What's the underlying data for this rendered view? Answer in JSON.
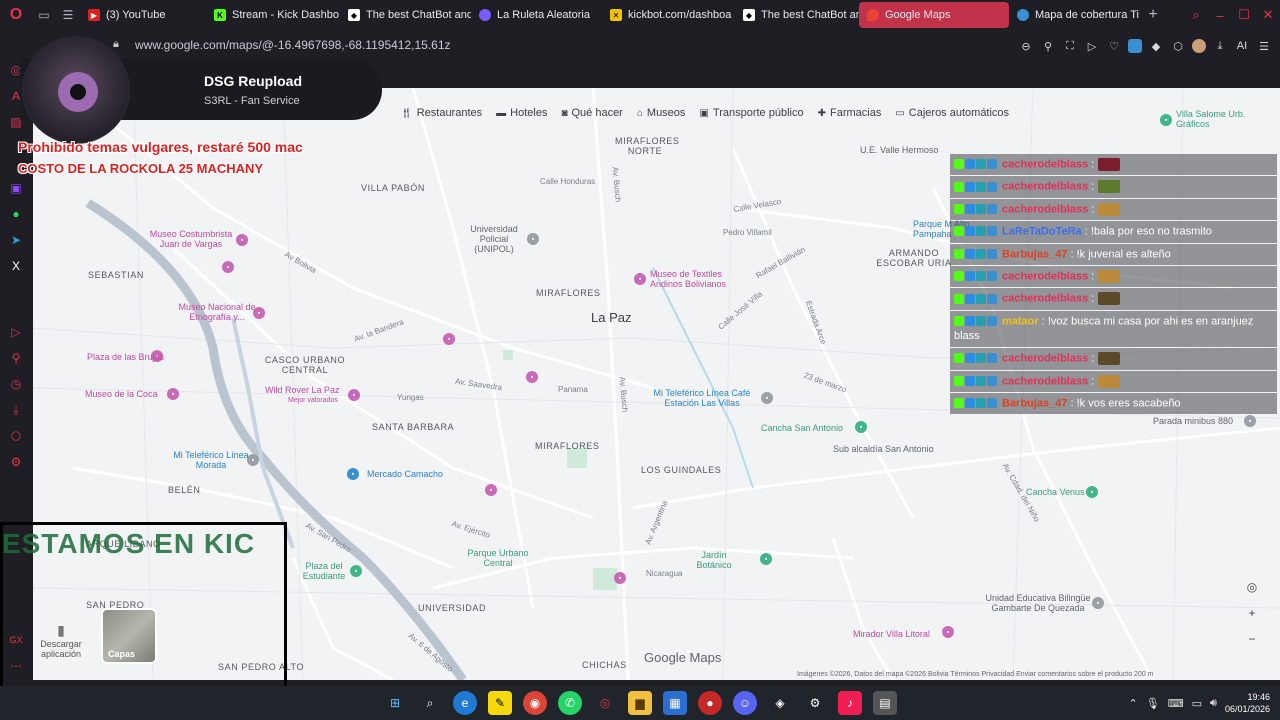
{
  "tabs": [
    {
      "label": "(3) YouTube",
      "color": "#e02020",
      "icon": "youtube-icon"
    },
    {
      "label": "Stream - Kick Dashbo",
      "color": "#53fc18",
      "icon": "kick-icon"
    },
    {
      "label": "The best ChatBot and",
      "color": "#ffffff",
      "icon": "chatbot-icon"
    },
    {
      "label": "La Ruleta Aleatoria",
      "color": "#7a5cff",
      "icon": "roulette-icon"
    },
    {
      "label": "kickbot.com/dashboa",
      "color": "#f2c200",
      "icon": "kickbot-icon"
    },
    {
      "label": "The best ChatBot and",
      "color": "#ffffff",
      "icon": "chatbot-icon"
    },
    {
      "label": "Google Maps",
      "color": "#ea4335",
      "icon": "maps-icon",
      "active": true
    },
    {
      "label": "Mapa de cobertura Ti",
      "color": "#3a8fd1",
      "icon": "coverage-icon"
    }
  ],
  "address": {
    "url": "www.google.com/maps/@-16.4967698,-68.1195412,15.61z"
  },
  "stream": {
    "title": "DSG Reupload",
    "subtitle": "S3RL - Fan Service"
  },
  "rules": {
    "line1": "Prohibido temas vulgares, restaré 500 mac",
    "line2": "COSTO DE LA ROCKOLA 25 MACHANY"
  },
  "chips": [
    {
      "label": "Restaurantes",
      "icon": "fork-knife-icon"
    },
    {
      "label": "Hoteles",
      "icon": "bed-icon"
    },
    {
      "label": "Qué hacer",
      "icon": "camera-icon"
    },
    {
      "label": "Museos",
      "icon": "museum-icon"
    },
    {
      "label": "Transporte público",
      "icon": "bus-icon"
    },
    {
      "label": "Farmacias",
      "icon": "pharmacy-icon"
    },
    {
      "label": "Cajeros automáticos",
      "icon": "atm-icon"
    }
  ],
  "chat": [
    {
      "user": "cacherodelblass",
      "msg": " :",
      "user_color": "#e0305a",
      "emote": "#7a1d2c"
    },
    {
      "user": "cacherodelblass",
      "msg": " :",
      "user_color": "#e0305a",
      "emote": "#5d7a2c"
    },
    {
      "user": "cacherodelblass",
      "msg": " :",
      "user_color": "#e0305a",
      "emote": "#b88a3a"
    },
    {
      "user": "LaReTaDoTeRa",
      "msg": " : !bala por eso no trasmito",
      "user_color": "#3a6ee8",
      "emote": ""
    },
    {
      "user": "Barbujas_47",
      "msg": " : !k juvenal es alteño",
      "user_color": "#e04020",
      "emote": ""
    },
    {
      "user": "cacherodelblass",
      "msg": " :",
      "user_color": "#e0305a",
      "emote": "#b88a3a"
    },
    {
      "user": "cacherodelblass",
      "msg": " :",
      "user_color": "#e0305a",
      "emote": "#5a4a2a"
    },
    {
      "user": "mataor",
      "msg": " : !voz busca mi casa por ahi es en aranjuez blass",
      "user_color": "#f0c020",
      "emote": ""
    },
    {
      "user": "cacherodelblass",
      "msg": " :",
      "user_color": "#e0305a",
      "emote": "#5a4a2a"
    },
    {
      "user": "cacherodelblass",
      "msg": " :",
      "user_color": "#e0305a",
      "emote": "#b88a3a"
    },
    {
      "user": "Barbujas_47",
      "msg": " : !k vos eres sacabeño",
      "user_color": "#e04020",
      "emote": ""
    }
  ],
  "map": {
    "neighborhoods": [
      "VILLA PABÓN",
      "SEBASTIAN",
      "CASCO URBANO CENTRAL",
      "SANTA BARBARA",
      "MIRAFLORES NORTE",
      "MIRAFLORES",
      "MIRAFLORES",
      "LOS GUINDALES",
      "BELÉN",
      "SAN PEDRO",
      "UNIVERSIDAD",
      "CHICHAS",
      "ARMANDO ESCOBAR URIA",
      "SAN PEDRO ALTO",
      "ARQUE LIBANO"
    ],
    "city": "La Paz",
    "pois": [
      "Museo Costumbrista Juan de Vargas",
      "Museo Nacional de Etnografía y...",
      "Museo de Textiles Andinos Bolivianos",
      "Wild Rover La Paz",
      "Mejor valorados",
      "Mercado Camacho",
      "Mi Teleférico Línea Café Estación Las Villas",
      "Cancha San Antonio",
      "Sub alcaldía San Antonio",
      "Parada minibus 880",
      "Cancha Venus",
      "Mi Teleférico Línea Morada",
      "Parque Urbano Central",
      "Jardín Botánico",
      "Plaza del Estudiante",
      "Unidad Educativa Bilingüe Gambarte De Quezada",
      "Mirador Villa Litoral",
      "Universidad Policial (UNIPOL)",
      "Museo de la Coca",
      "Plaza de las Brujas",
      "U.E. Valle Hermoso",
      "Villa Salome Urb. Gráficos",
      "Parque M Alto Pampaha"
    ],
    "streets": [
      "Calle Honduras",
      "Av. Busch",
      "Av. Busch",
      "Av. Saavedra",
      "Panama",
      "Av. Ejército",
      "Av. Argentina",
      "Nicaragua",
      "Av. Cdad. del Niño",
      "23 de marzo",
      "Av. 6 de Agosto",
      "Yungas",
      "Estrada Arce",
      "Av. San Pedro",
      "Av Bolivia",
      "Pedro Villamil",
      "Calle Velasco",
      "Rafael Ballivián",
      "Calle José Villa",
      "Av. la Bandera"
    ],
    "logo": "Google Maps",
    "attribution": "Imágenes ©2026, Datos del mapa ©2026   Bolivia   Términos   Privacidad   Enviar comentarios sobre el producto   200 m",
    "download_app": "Descargar aplicación",
    "layers": "Capas"
  },
  "overlay": {
    "box_text": "ESTAMOS EN KIC"
  },
  "taskbar": {
    "time": "19:46",
    "date": "06/01/2026"
  }
}
